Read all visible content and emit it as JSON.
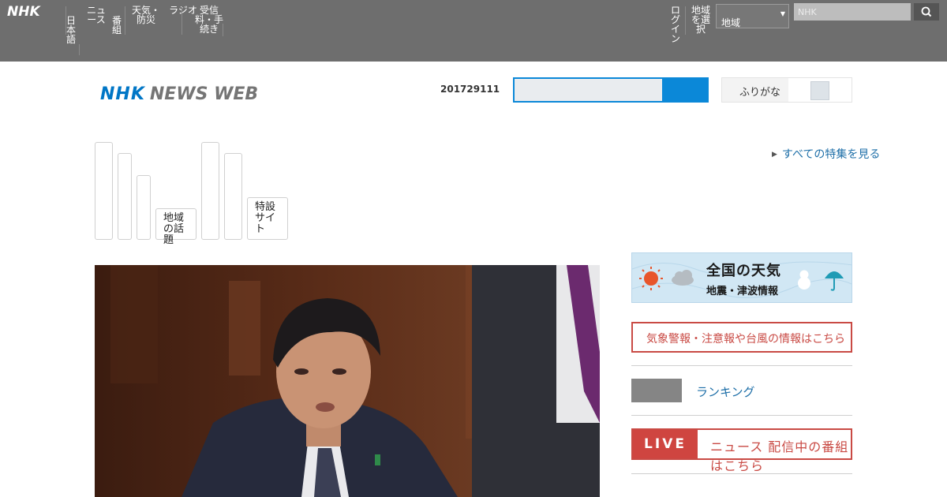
{
  "global_bar": {
    "logo": "NHK",
    "nav_items": [
      "日本語",
      "ニュース",
      "番組",
      "天気・防災",
      "ラジオ",
      "受信料・手続き"
    ],
    "nav_items_right": [
      "ログイン",
      "地域を選択"
    ],
    "region_select": "地域",
    "search_placeholder": "NHK"
  },
  "header": {
    "logo_nhk": "NHK",
    "logo_news": "NEWS WEB",
    "date": "201729111",
    "toggle_label": "ふりがな"
  },
  "categories": [
    "地域の話題",
    "特設サイト"
  ],
  "feature_link": "すべての特集を見る",
  "sidebar": {
    "weather_title": "全国の天気",
    "weather_sub": "地震・津波情報",
    "alert_text": "気象警報・注意報や台風の情報はこちら",
    "grey_link": "ランキング",
    "live_badge": "LIVE",
    "live_text": "ニュース 配信中の番組はこちら"
  },
  "colors": {
    "accent": "#0b88d8",
    "brand": "#0076c6",
    "live": "#cf4540",
    "global_bar": "#6e6e6e"
  }
}
